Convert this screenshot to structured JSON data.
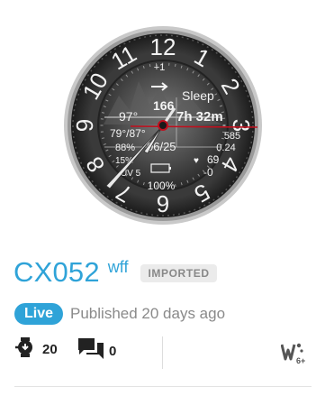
{
  "watchface": {
    "dial_numbers": [
      "12",
      "1",
      "2",
      "3",
      "4",
      "5",
      "6",
      "7",
      "8",
      "9",
      "10",
      "11"
    ],
    "steps_up": "+1",
    "sleep_label": "Sleep",
    "sleep_time": "7h 32m",
    "value_166": "166",
    "temp_now": "97°",
    "temp_range": "79°/87°",
    "date": "06/25",
    "humidity": "88%",
    "value_585": "585",
    "value_024": "0.24",
    "heart_rate": "69",
    "percent_15": "15%",
    "uv_label": "UV 5",
    "delta": "-0",
    "battery": "100%"
  },
  "title": "CX052",
  "format": "wff",
  "badge": "IMPORTED",
  "status": {
    "live": "Live",
    "published": "Published 20 days ago"
  },
  "stats": {
    "installs": "20",
    "comments": "0"
  },
  "colors": {
    "accent": "#2fa3d8",
    "badge_bg": "#ebebeb",
    "muted": "#8a8a8a",
    "second_hand": "#c0101e"
  },
  "icons": {
    "installs": "watch-download-icon",
    "comments": "chat-bubbles-icon",
    "platform": "wear-os-6-plus-icon"
  }
}
